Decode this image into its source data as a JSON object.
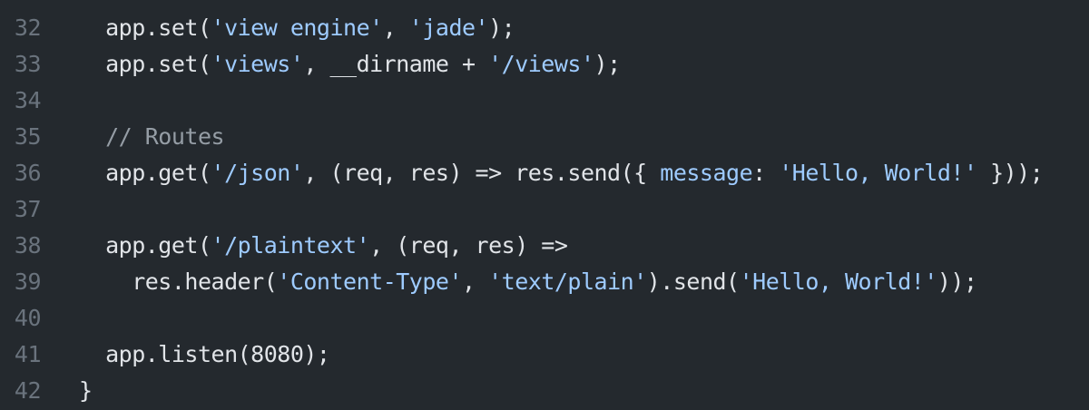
{
  "editor": {
    "theme_colors": {
      "background": "#24292e",
      "line_number": "#6a737d",
      "text": "#e1e4e8",
      "string": "#9ecbff",
      "comment": "#959da5",
      "number": "#79b8ff"
    },
    "lines": [
      {
        "number": "32",
        "tokens": [
          {
            "text": "  app.set(",
            "type": "plain"
          },
          {
            "text": "'view engine'",
            "type": "string"
          },
          {
            "text": ", ",
            "type": "plain"
          },
          {
            "text": "'jade'",
            "type": "string"
          },
          {
            "text": ");",
            "type": "plain"
          }
        ]
      },
      {
        "number": "33",
        "tokens": [
          {
            "text": "  app.set(",
            "type": "plain"
          },
          {
            "text": "'views'",
            "type": "string"
          },
          {
            "text": ", __dirname + ",
            "type": "plain"
          },
          {
            "text": "'/views'",
            "type": "string"
          },
          {
            "text": ");",
            "type": "plain"
          }
        ]
      },
      {
        "number": "34",
        "tokens": []
      },
      {
        "number": "35",
        "tokens": [
          {
            "text": "  // Routes",
            "type": "comment"
          }
        ]
      },
      {
        "number": "36",
        "tokens": [
          {
            "text": "  app.get(",
            "type": "plain"
          },
          {
            "text": "'/json'",
            "type": "string"
          },
          {
            "text": ", (req, res) => res.send({ ",
            "type": "plain"
          },
          {
            "text": "message",
            "type": "string"
          },
          {
            "text": ": ",
            "type": "plain"
          },
          {
            "text": "'Hello, World!'",
            "type": "string"
          },
          {
            "text": " }));",
            "type": "plain"
          }
        ]
      },
      {
        "number": "37",
        "tokens": []
      },
      {
        "number": "38",
        "tokens": [
          {
            "text": "  app.get(",
            "type": "plain"
          },
          {
            "text": "'/plaintext'",
            "type": "string"
          },
          {
            "text": ", (req, res) =>",
            "type": "plain"
          }
        ]
      },
      {
        "number": "39",
        "tokens": [
          {
            "text": "    res.header(",
            "type": "plain"
          },
          {
            "text": "'Content-Type'",
            "type": "string"
          },
          {
            "text": ", ",
            "type": "plain"
          },
          {
            "text": "'text/plain'",
            "type": "string"
          },
          {
            "text": ").send(",
            "type": "plain"
          },
          {
            "text": "'Hello, World!'",
            "type": "string"
          },
          {
            "text": "));",
            "type": "plain"
          }
        ]
      },
      {
        "number": "40",
        "tokens": []
      },
      {
        "number": "41",
        "tokens": [
          {
            "text": "  app.listen(8080);",
            "type": "plain"
          }
        ]
      },
      {
        "number": "42",
        "tokens": [
          {
            "text": "}",
            "type": "plain"
          }
        ]
      }
    ]
  }
}
